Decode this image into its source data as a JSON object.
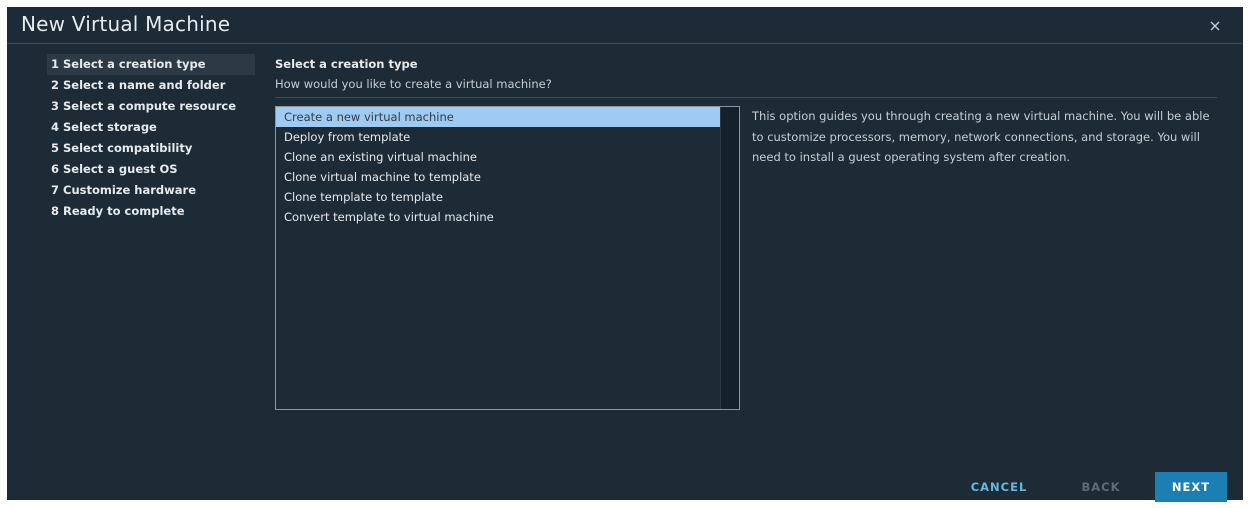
{
  "dialog": {
    "title": "New Virtual Machine",
    "close_icon": "close-icon"
  },
  "steps": [
    {
      "label": "1 Select a creation type",
      "active": true
    },
    {
      "label": "2 Select a name and folder",
      "active": false
    },
    {
      "label": "3 Select a compute resource",
      "active": false
    },
    {
      "label": "4 Select storage",
      "active": false
    },
    {
      "label": "5 Select compatibility",
      "active": false
    },
    {
      "label": "6 Select a guest OS",
      "active": false
    },
    {
      "label": "7 Customize hardware",
      "active": false
    },
    {
      "label": "8 Ready to complete",
      "active": false
    }
  ],
  "section": {
    "title": "Select a creation type",
    "subtitle": "How would you like to create a virtual machine?"
  },
  "options": [
    {
      "label": "Create a new virtual machine",
      "selected": true
    },
    {
      "label": "Deploy from template",
      "selected": false
    },
    {
      "label": "Clone an existing virtual machine",
      "selected": false
    },
    {
      "label": "Clone virtual machine to template",
      "selected": false
    },
    {
      "label": "Clone template to template",
      "selected": false
    },
    {
      "label": "Convert template to virtual machine",
      "selected": false
    }
  ],
  "description": "This option guides you through creating a new virtual machine. You will be able to customize processors, memory, network connections, and storage. You will need to install a guest operating system after creation.",
  "buttons": {
    "cancel": "CANCEL",
    "back": "BACK",
    "next": "NEXT"
  },
  "colors": {
    "background": "#1d2b36",
    "selected_option": "#9fcbf2",
    "primary_button": "#1c7fb4",
    "link_button": "#67b7e0"
  }
}
